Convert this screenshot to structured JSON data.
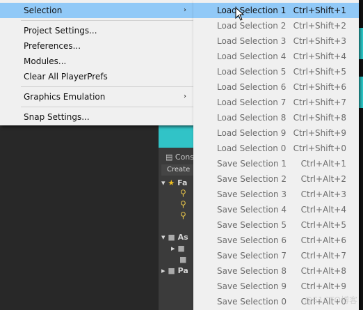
{
  "menu": {
    "items": [
      {
        "label": "Selection",
        "arrow": "›"
      },
      {
        "label": "Project Settings..."
      },
      {
        "label": "Preferences..."
      },
      {
        "label": "Modules..."
      },
      {
        "label": "Clear All PlayerPrefs"
      },
      {
        "label": "Graphics Emulation",
        "arrow": "›"
      },
      {
        "label": "Snap Settings..."
      }
    ]
  },
  "submenu": {
    "items": [
      {
        "label": "Load Selection 1",
        "shortcut": "Ctrl+Shift+1"
      },
      {
        "label": "Load Selection 2",
        "shortcut": "Ctrl+Shift+2"
      },
      {
        "label": "Load Selection 3",
        "shortcut": "Ctrl+Shift+3"
      },
      {
        "label": "Load Selection 4",
        "shortcut": "Ctrl+Shift+4"
      },
      {
        "label": "Load Selection 5",
        "shortcut": "Ctrl+Shift+5"
      },
      {
        "label": "Load Selection 6",
        "shortcut": "Ctrl+Shift+6"
      },
      {
        "label": "Load Selection 7",
        "shortcut": "Ctrl+Shift+7"
      },
      {
        "label": "Load Selection 8",
        "shortcut": "Ctrl+Shift+8"
      },
      {
        "label": "Load Selection 9",
        "shortcut": "Ctrl+Shift+9"
      },
      {
        "label": "Load Selection 0",
        "shortcut": "Ctrl+Shift+0"
      },
      {
        "label": "Save Selection 1",
        "shortcut": "Ctrl+Alt+1"
      },
      {
        "label": "Save Selection 2",
        "shortcut": "Ctrl+Alt+2"
      },
      {
        "label": "Save Selection 3",
        "shortcut": "Ctrl+Alt+3"
      },
      {
        "label": "Save Selection 4",
        "shortcut": "Ctrl+Alt+4"
      },
      {
        "label": "Save Selection 5",
        "shortcut": "Ctrl+Alt+5"
      },
      {
        "label": "Save Selection 6",
        "shortcut": "Ctrl+Alt+6"
      },
      {
        "label": "Save Selection 7",
        "shortcut": "Ctrl+Alt+7"
      },
      {
        "label": "Save Selection 8",
        "shortcut": "Ctrl+Alt+8"
      },
      {
        "label": "Save Selection 9",
        "shortcut": "Ctrl+Alt+9"
      },
      {
        "label": "Save Selection 0",
        "shortcut": "Ctrl+Alt+0"
      }
    ]
  },
  "background": {
    "console_tab": "Cons",
    "create_button": "Create",
    "favorites_label": "Fa",
    "assets_label": "As",
    "packages_label": "Pa"
  },
  "watermark": "@51CTO博客",
  "colors": {
    "highlight": "#91c9f7",
    "menu_bg": "#f0f0f0",
    "teal": "#31c3c7"
  },
  "icons": {
    "submenu_arrow": "chevron-right-icon",
    "cursor": "mouse-pointer-icon",
    "star": "star-icon",
    "search": "search-icon",
    "folder": "folder-icon"
  }
}
